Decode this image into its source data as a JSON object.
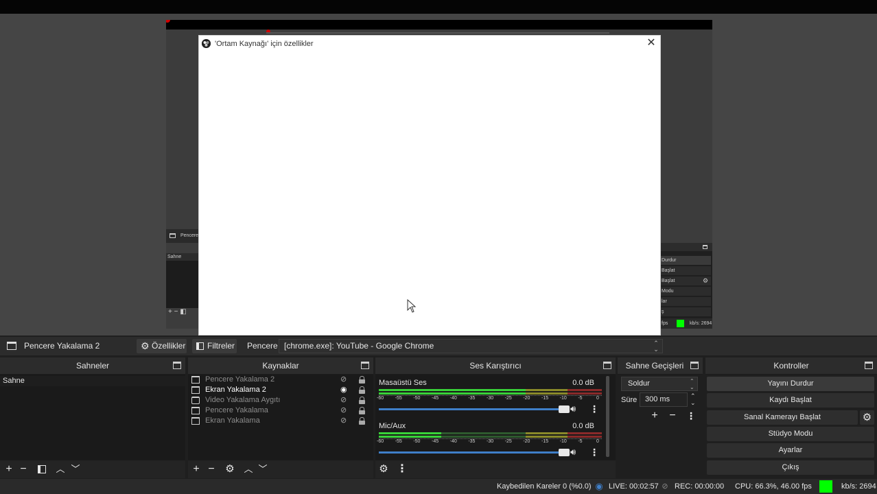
{
  "window": {
    "dialog_title": "'Ortam Kaynağı' için özellikler",
    "close_glyph": "✕"
  },
  "preview_mini": {
    "source_label": "Pencere",
    "scene_label": "Sahne",
    "ctrl_items": [
      "Durdur",
      "Başlat",
      "Başlat",
      "Modu",
      "lar",
      "ş"
    ],
    "fps": "fps",
    "kbs": "kb/s: 2694"
  },
  "context": {
    "source_name": "Pencere Yakalama 2",
    "properties": "Özellikler",
    "filters": "Filtreler",
    "window_label": "Pencere",
    "window_value": "[chrome.exe]: YouTube - Google Chrome"
  },
  "scenes": {
    "title": "Sahneler",
    "items": [
      "Sahne"
    ]
  },
  "sources": {
    "title": "Kaynaklar",
    "items": [
      {
        "label": "Pencere Yakalama 2",
        "visible": false
      },
      {
        "label": "Ekran Yakalama 2",
        "visible": true
      },
      {
        "label": "Video Yakalama Aygıtı",
        "visible": false
      },
      {
        "label": "Pencere Yakalama",
        "visible": false
      },
      {
        "label": "Ekran Yakalama",
        "visible": false
      }
    ]
  },
  "mixer": {
    "title": "Ses Karıştırıcı",
    "channels": [
      {
        "name": "Masaüstü Ses",
        "db": "0.0 dB",
        "level": 0.67
      },
      {
        "name": "Mic/Aux",
        "db": "0.0 dB",
        "level": 0.28
      }
    ],
    "scale": [
      "-60",
      "-55",
      "-50",
      "-45",
      "-40",
      "-35",
      "-30",
      "-25",
      "-20",
      "-15",
      "-10",
      "-5",
      "0"
    ]
  },
  "transitions": {
    "title": "Sahne Geçişleri",
    "type": "Soldur",
    "duration_label": "Süre",
    "duration_value": "300 ms"
  },
  "controls": {
    "title": "Kontroller",
    "buttons": [
      "Yayını Durdur",
      "Kaydı Başlat",
      "Sanal Kamerayı Başlat",
      "Stüdyo Modu",
      "Ayarlar",
      "Çıkış"
    ]
  },
  "status": {
    "dropped": "Kaybedilen Kareler 0 (%0.0)",
    "live": "LIVE: 00:02:57",
    "rec": "REC: 00:00:00",
    "cpu": "CPU: 66.3%, 46.00 fps",
    "kbs": "kb/s: 2694",
    "indicator_color": "#00ff00"
  },
  "colors": {
    "accent_blue": "#3f7fc9",
    "meter_green": "#39d339"
  }
}
